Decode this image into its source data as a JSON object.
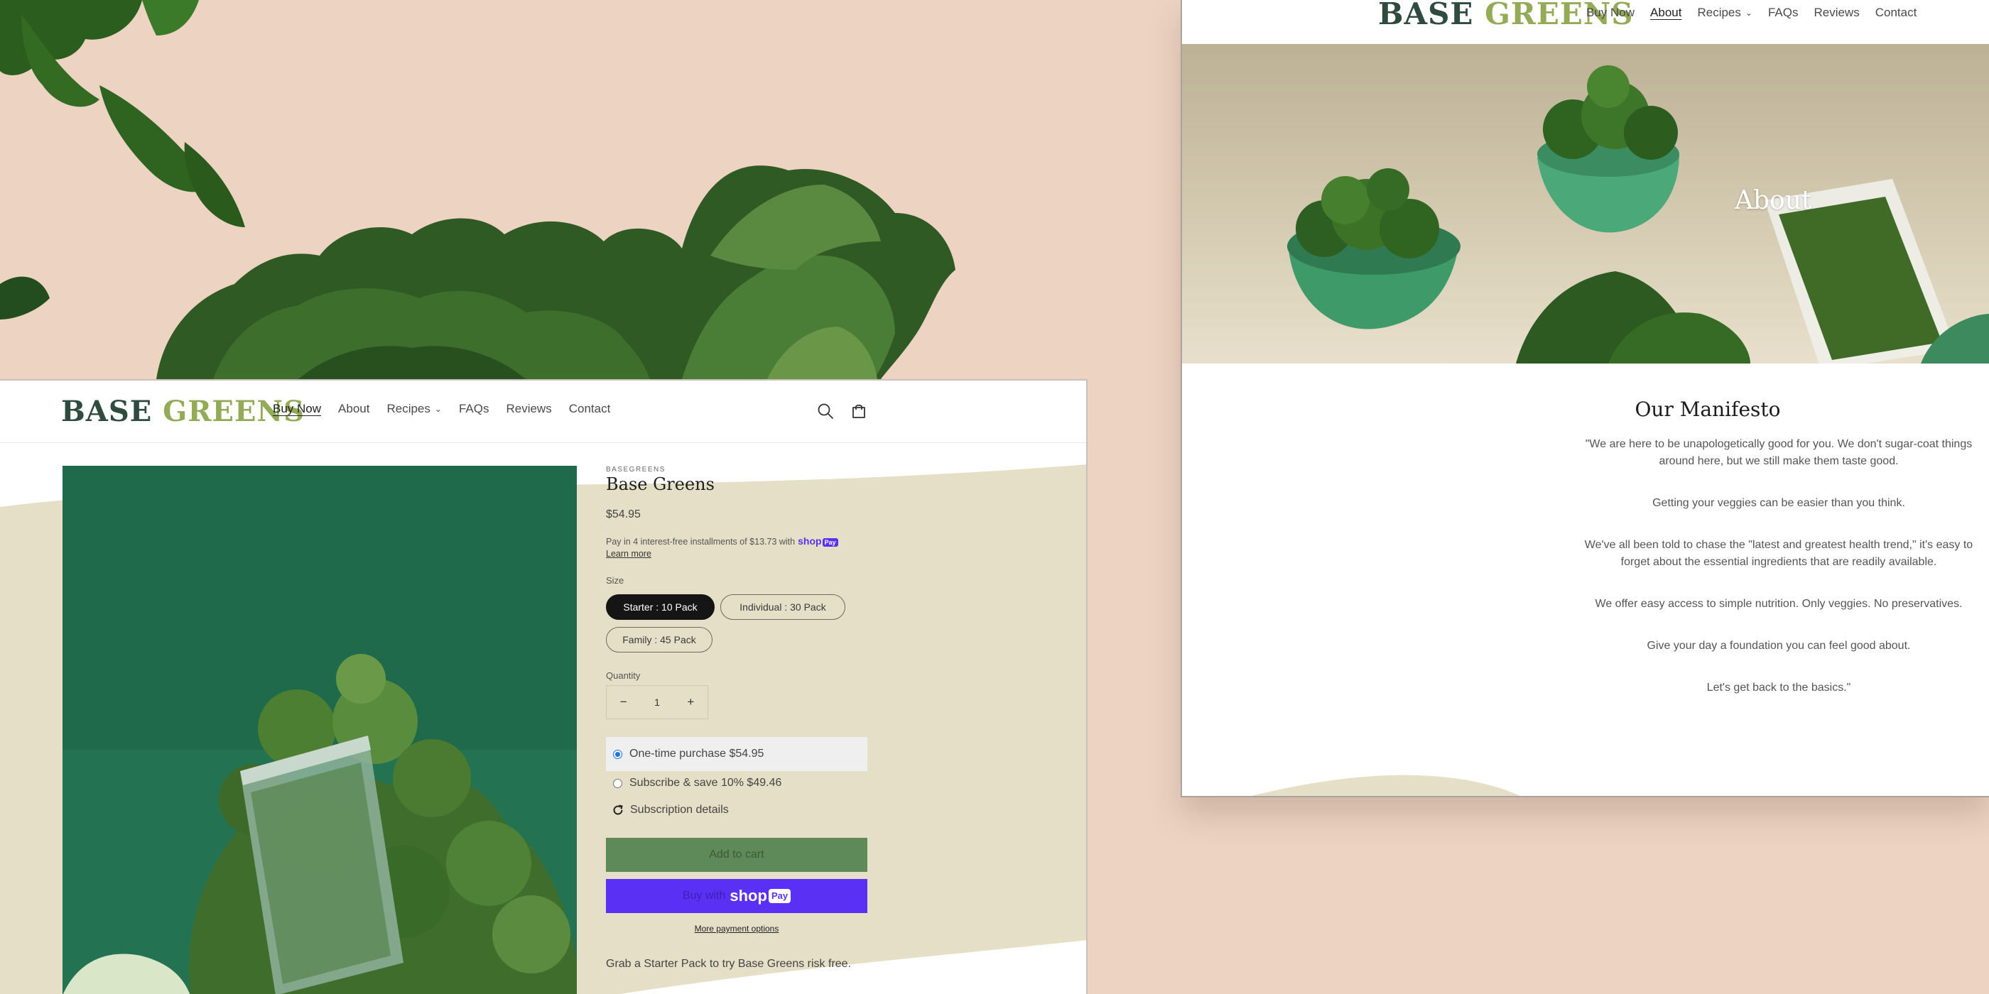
{
  "colors": {
    "background": "#ecd3c2",
    "logo_dark": "#2f4b40",
    "logo_green": "#93ab57",
    "cream": "#e4dfc6",
    "add_to_cart": "#5e8a59",
    "shop_pay": "#5a31f4"
  },
  "product_page": {
    "logo": {
      "word1": "BASE",
      "word2": "GREENS"
    },
    "nav": [
      "Buy Now",
      "About",
      "Recipes",
      "FAQs",
      "Reviews",
      "Contact"
    ],
    "active_nav": "Buy Now",
    "icons": [
      "search-icon",
      "cart-icon"
    ],
    "vendor": "BASEGREENS",
    "title": "Base Greens",
    "price": "$54.95",
    "installments_text": "Pay in 4 interest-free installments of $13.73 with",
    "shop_logo": "shop",
    "shop_pay_badge": "Pay",
    "learn_more": "Learn more",
    "size_label": "Size",
    "sizes": [
      "Starter : 10 Pack",
      "Individual : 30 Pack",
      "Family : 45 Pack"
    ],
    "selected_size": "Starter : 10 Pack",
    "quantity_label": "Quantity",
    "quantity_minus": "−",
    "quantity_value": "1",
    "quantity_plus": "+",
    "purchase_options": [
      "One-time purchase $54.95",
      "Subscribe & save 10% $49.46"
    ],
    "selected_option": "One-time purchase $54.95",
    "subscription_details": "Subscription details",
    "add_to_cart": "Add to cart",
    "buy_with": "Buy with",
    "buy_with_logo": "shop",
    "buy_with_badge": "Pay",
    "more_payment": "More payment options",
    "description": "Grab a Starter Pack to try Base Greens risk free."
  },
  "about_page": {
    "logo": {
      "word1": "BASE",
      "word2": "GREENS"
    },
    "nav": [
      "Buy Now",
      "About",
      "Recipes",
      "FAQs",
      "Reviews",
      "Contact"
    ],
    "active_nav": "About",
    "hero_title": "About",
    "manifesto_title": "Our Manifesto",
    "manifesto": [
      "\"We are here to be unapologetically good for you. We don't sugar-coat things around here, but we still make them taste good.",
      "Getting your veggies can be easier than you think.",
      "We've all been told to chase the \"latest and greatest health trend,\" it's easy to forget about the essential ingredients that are readily available.",
      "We offer easy access to simple nutrition. Only veggies. No preservatives.",
      "Give your day a foundation you can feel good about.",
      "Let's get back to the basics.\""
    ]
  }
}
